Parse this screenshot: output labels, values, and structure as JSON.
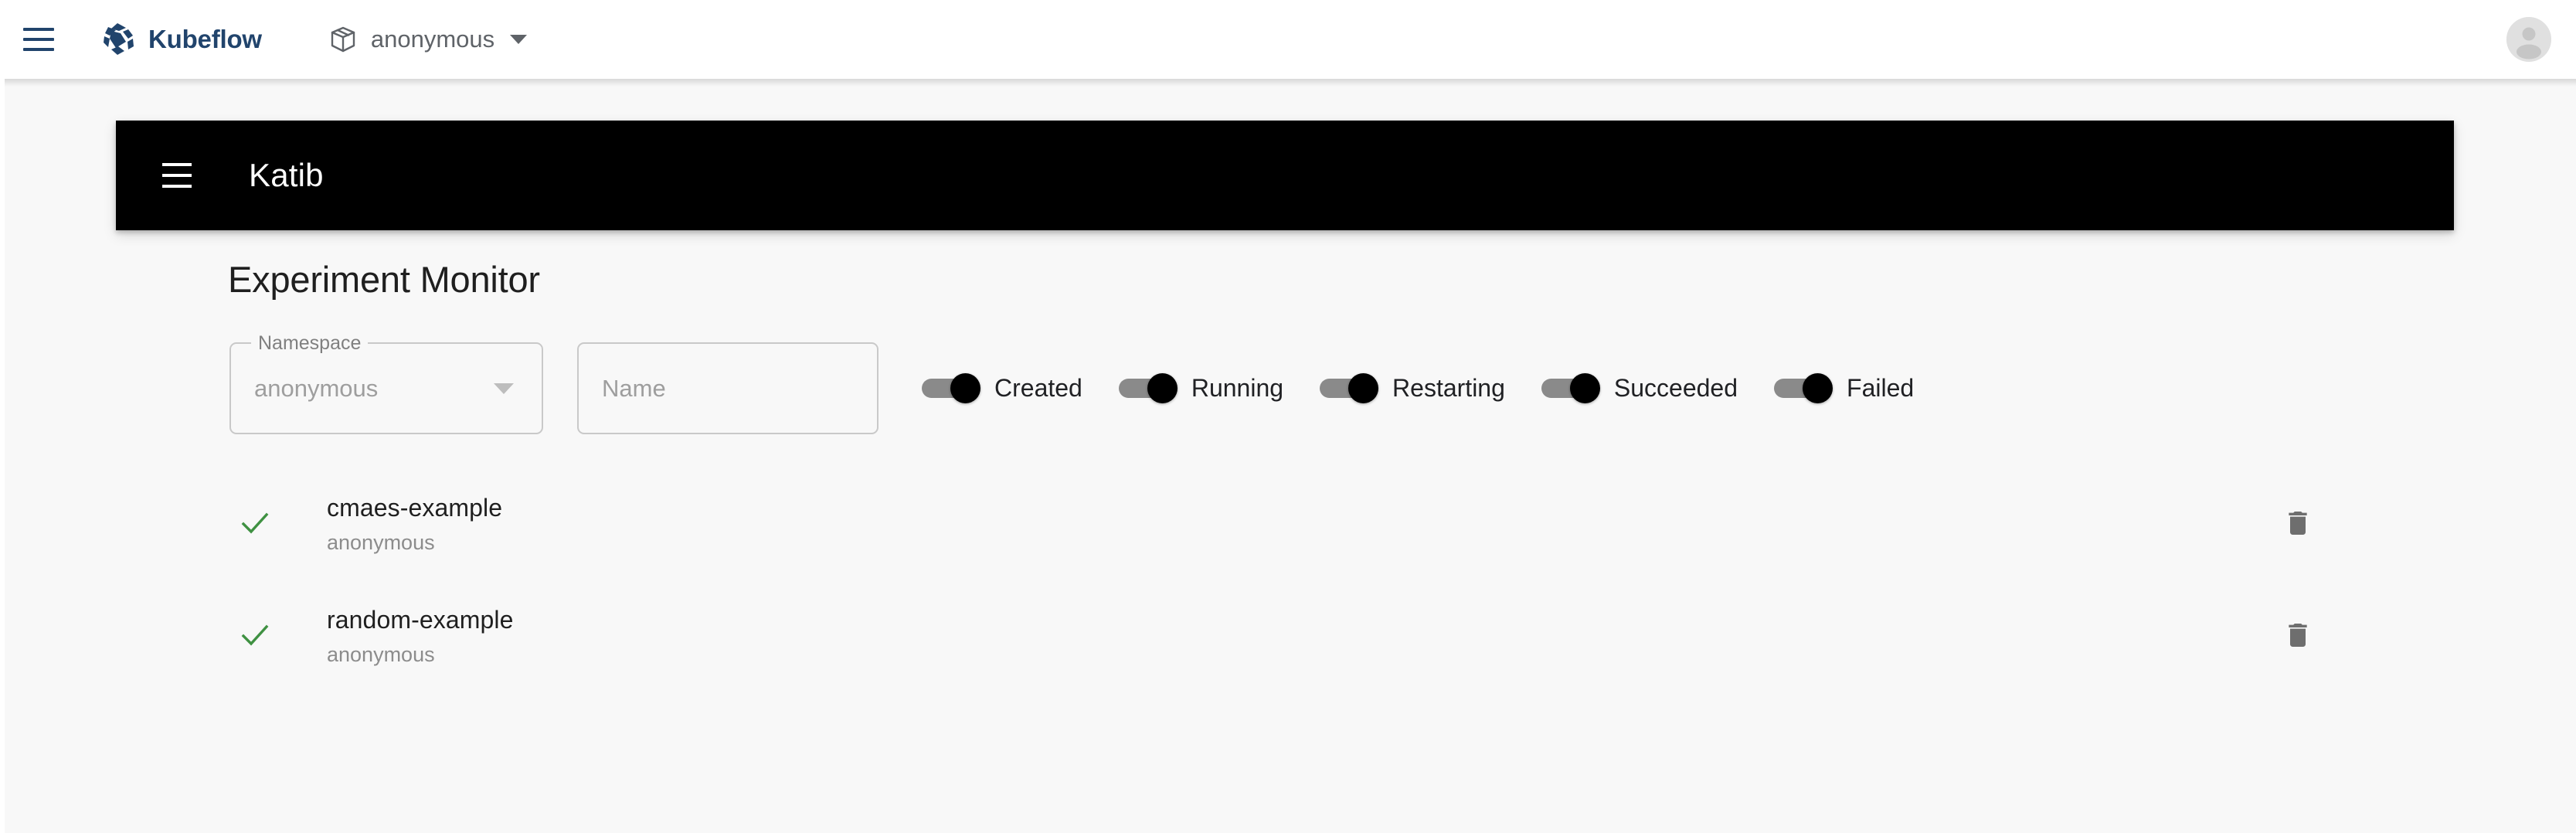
{
  "navbar": {
    "menu_icon": "hamburger-menu-icon",
    "logo_icon": "kubeflow-logo-icon",
    "brand": "Kubeflow",
    "namespace_icon": "package-box-icon",
    "namespace": "anonymous",
    "caret_icon": "chevron-down-icon",
    "avatar_icon": "user-avatar-icon",
    "brand_color": "#21446c"
  },
  "toolbar": {
    "menu_icon": "hamburger-menu-icon",
    "title": "Katib",
    "background_color": "#000000",
    "text_color": "#ffffff"
  },
  "page": {
    "title": "Experiment Monitor",
    "background_color": "#f8f8f8"
  },
  "filters": {
    "namespace_field": {
      "label": "Namespace",
      "value": "anonymous",
      "caret_icon": "dropdown-arrow-icon"
    },
    "name_field": {
      "placeholder": "Name",
      "value": ""
    },
    "status_toggles": [
      {
        "label": "Created",
        "on": true
      },
      {
        "label": "Running",
        "on": true
      },
      {
        "label": "Restarting",
        "on": true
      },
      {
        "label": "Succeeded",
        "on": true
      },
      {
        "label": "Failed",
        "on": true
      }
    ],
    "toggle_track_color": "#8a8a8a",
    "toggle_thumb_color": "#000000"
  },
  "experiments": {
    "status_icon": "check-mark-icon",
    "status_color": "#3f9142",
    "delete_icon": "trash-can-icon",
    "delete_color": "#6e6e6e",
    "rows": [
      {
        "status": "Succeeded",
        "name": "cmaes-example",
        "namespace": "anonymous"
      },
      {
        "status": "Succeeded",
        "name": "random-example",
        "namespace": "anonymous"
      }
    ]
  }
}
